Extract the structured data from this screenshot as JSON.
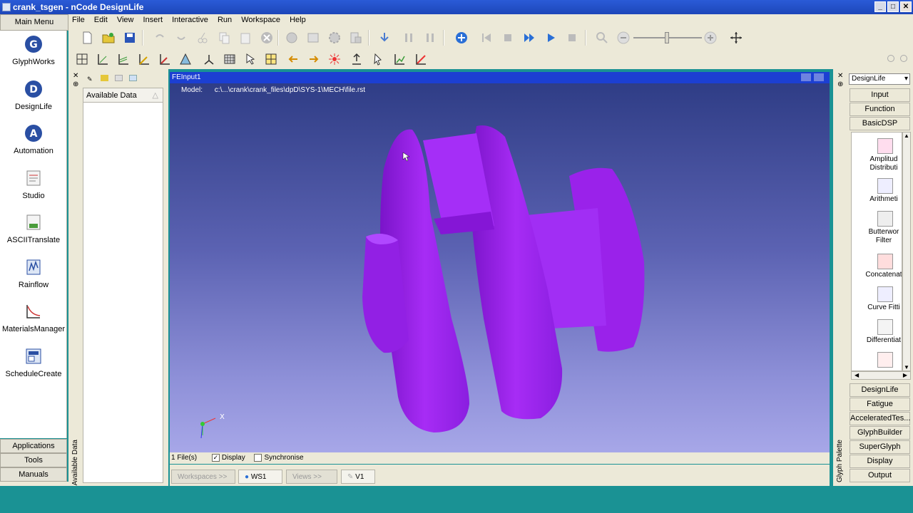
{
  "window": {
    "title": "crank_tsgen - nCode DesignLife"
  },
  "menu": [
    "File",
    "Edit",
    "View",
    "Insert",
    "Interactive",
    "Run",
    "Workspace",
    "Help"
  ],
  "left_panel": {
    "header": "Main Menu",
    "items": [
      "GlyphWorks",
      "DesignLife",
      "Automation",
      "Studio",
      "ASCIITranslate",
      "Rainflow",
      "MaterialsManager",
      "ScheduleCreate"
    ],
    "bottom": [
      "Applications",
      "Tools",
      "Manuals"
    ]
  },
  "data_panel": {
    "header": "Available Data",
    "vertical_tab": "Available Data"
  },
  "viewer": {
    "title": "FEInput1",
    "model_label": "Model:",
    "model_path": "c:\\...\\crank\\crank_files\\dpD\\SYS-1\\MECH\\file.rst",
    "axis_label": "X",
    "status": {
      "files": "1 File(s)",
      "display_label": "Display",
      "display_checked": true,
      "sync_label": "Synchronise",
      "sync_checked": false
    }
  },
  "tabs": {
    "workspaces": "Workspaces >>",
    "ws1": "WS1",
    "views": "Views >>",
    "v1": "V1"
  },
  "right_panel": {
    "dropdown": "DesignLife",
    "vertical_tab": "Glyph Palette",
    "top_buttons": [
      "Input",
      "Function",
      "BasicDSP"
    ],
    "palette_items": [
      {
        "line1": "Amplitud",
        "line2": "Distributi"
      },
      {
        "line1": "Arithmeti",
        "line2": ""
      },
      {
        "line1": "Butterwor",
        "line2": "Filter"
      },
      {
        "line1": "Concatenat",
        "line2": ""
      },
      {
        "line1": "Curve Fitti",
        "line2": ""
      },
      {
        "line1": "Differentiat",
        "line2": ""
      }
    ],
    "bottom_buttons": [
      "DesignLife",
      "Fatigue",
      "AcceleratedTes...",
      "GlyphBuilder",
      "SuperGlyph",
      "Display",
      "Output"
    ]
  },
  "colors": {
    "model": "#9b1fe8",
    "titlebar": "#1d46b9",
    "viewer_title": "#1c3fd2",
    "taskbar": "#1a9294"
  },
  "icons": {
    "toolbar_row1": [
      "new-icon",
      "open-icon",
      "save-icon",
      "undo-icon",
      "redo-icon",
      "cut-icon",
      "copy-icon",
      "paste-icon",
      "delete-icon",
      "settings-icon",
      "properties-icon",
      "gear-icon",
      "export-icon",
      "download-icon",
      "step-back-icon",
      "step-forward-icon",
      "add-circle-icon",
      "skip-start-icon",
      "stop-icon",
      "fast-forward-icon",
      "play-icon",
      "stop-square-icon",
      "zoom-fit-icon",
      "zoom-out-icon",
      "zoom-in-icon",
      "pan-icon"
    ],
    "toolbar_row2": [
      "grid-icon",
      "axis-icon",
      "axis2-icon",
      "axis3-icon",
      "axis4-icon",
      "surface-icon",
      "coordinate-icon",
      "mesh-icon",
      "select-icon",
      "mesh2-icon",
      "arrow-left-icon",
      "arrow-right-icon",
      "star-icon",
      "export2-icon",
      "pointer-icon",
      "graph-icon",
      "graph2-icon"
    ]
  }
}
